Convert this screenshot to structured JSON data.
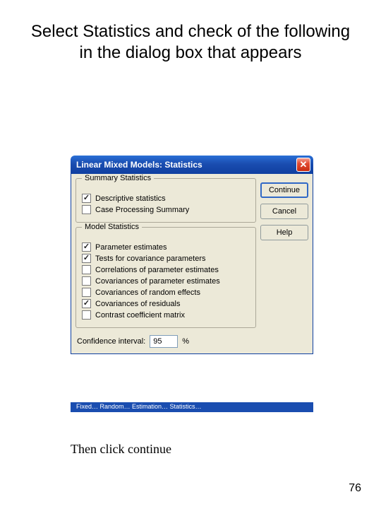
{
  "slide": {
    "title": "Select Statistics and check of the following in the dialog box that appears",
    "caption": "Then click continue",
    "page_number": "76"
  },
  "bg_strip": "Fixed…    Random…    Estimation…    Statistics…",
  "dialog": {
    "title": "Linear Mixed Models: Statistics",
    "buttons": {
      "continue": "Continue",
      "cancel": "Cancel",
      "help": "Help"
    },
    "groups": {
      "summary": {
        "legend": "Summary Statistics",
        "items": [
          {
            "label": "Descriptive statistics",
            "checked": true
          },
          {
            "label": "Case Processing Summary",
            "checked": false
          }
        ]
      },
      "model": {
        "legend": "Model Statistics",
        "items": [
          {
            "label": "Parameter estimates",
            "checked": true
          },
          {
            "label": "Tests for covariance parameters",
            "checked": true
          },
          {
            "label": "Correlations of parameter estimates",
            "checked": false
          },
          {
            "label": "Covariances of parameter estimates",
            "checked": false
          },
          {
            "label": "Covariances of random effects",
            "checked": false
          },
          {
            "label": "Covariances of residuals",
            "checked": true
          },
          {
            "label": "Contrast coefficient matrix",
            "checked": false
          }
        ]
      }
    },
    "ci": {
      "label": "Confidence interval:",
      "value": "95",
      "unit": "%"
    }
  }
}
